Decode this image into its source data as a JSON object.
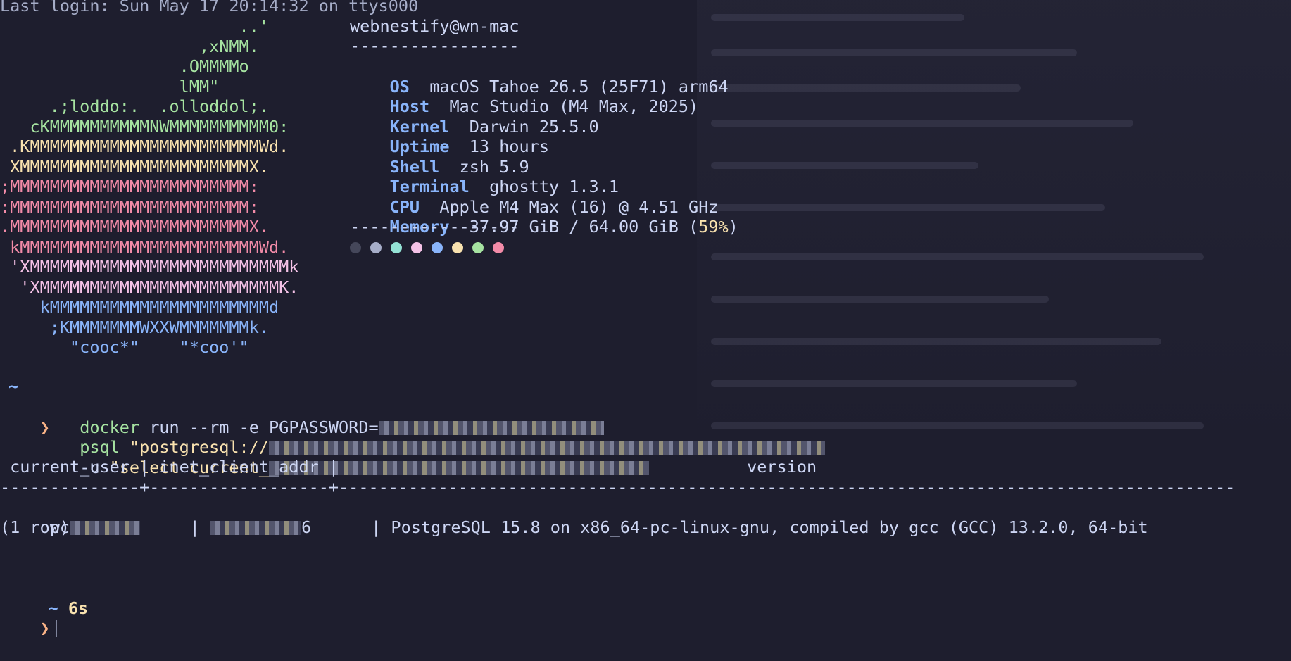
{
  "terminal": {
    "last_login": "Last login: Sun May 17 20:14:32 on ttys000",
    "logo": [
      {
        "text": "                        ..'",
        "color": "green"
      },
      {
        "text": "                    ,xNMM.",
        "color": "green"
      },
      {
        "text": "                  .OMMMMo",
        "color": "green"
      },
      {
        "text": "                  lMM\"",
        "color": "green"
      },
      {
        "text": "     .;loddo:.  .olloddol;.",
        "color": "green"
      },
      {
        "text": "   cKMMMMMMMMMMNWMMMMMMMMMM0:",
        "color": "green"
      },
      {
        "text": " .KMMMMMMMMMMMMMMMMMMMMMMMWd.",
        "color": "yellow"
      },
      {
        "text": " XMMMMMMMMMMMMMMMMMMMMMMMX.",
        "color": "yellow"
      },
      {
        "text": ";MMMMMMMMMMMMMMMMMMMMMMMM:",
        "color": "red"
      },
      {
        "text": ":MMMMMMMMMMMMMMMMMMMMMMMM:",
        "color": "red"
      },
      {
        "text": ".MMMMMMMMMMMMMMMMMMMMMMMMX.",
        "color": "red"
      },
      {
        "text": " kMMMMMMMMMMMMMMMMMMMMMMMMWd.",
        "color": "red"
      },
      {
        "text": " 'XMMMMMMMMMMMMMMMMMMMMMMMMMMk",
        "color": "pink"
      },
      {
        "text": "  'XMMMMMMMMMMMMMMMMMMMMMMMMK.",
        "color": "pink"
      },
      {
        "text": "    kMMMMMMMMMMMMMMMMMMMMMMd",
        "color": "blue"
      },
      {
        "text": "     ;KMMMMMMMWXXWMMMMMMMk.",
        "color": "blue"
      },
      {
        "text": "       \"cooc*\"    \"*coo'\"",
        "color": "blue"
      }
    ],
    "sysinfo": {
      "user_host": "webnestify@wn-mac",
      "separator": "-----------------",
      "rows": [
        {
          "key": "OS",
          "value": "macOS Tahoe 26.5 (25F71) arm64"
        },
        {
          "key": "Host",
          "value": "Mac Studio (M4 Max, 2025)"
        },
        {
          "key": "Kernel",
          "value": "Darwin 25.5.0"
        },
        {
          "key": "Uptime",
          "value": "13 hours"
        },
        {
          "key": "Shell",
          "value": "zsh 5.9"
        },
        {
          "key": "Terminal",
          "value": "ghostty 1.3.1"
        },
        {
          "key": "CPU",
          "value": "Apple M4 Max (16) @ 4.51 GHz"
        }
      ],
      "memory_key": "Memory",
      "memory_value": "37.97 GiB / 64.00 GiB (",
      "memory_pct": "59%",
      "memory_close": ")",
      "palette": [
        "#45475a",
        "#a6adc8",
        "#94e2d5",
        "#f5c2e7",
        "#89b4fa",
        "#f9e2af",
        "#a6e3a1",
        "#f38ba8"
      ]
    },
    "prompt1": {
      "dir": "~",
      "arrow": "❯",
      "cmd_name": "docker",
      "cmd_args": " run --rm -e PGPASSWORD=",
      "line2_cmd": "psql",
      "line2_str": " \"postgresql://",
      "line3_flag": "-c",
      "line3_str": " \"select current_"
    },
    "output": {
      "header": " current_user | inet_client_addr |                                         version",
      "divider": "--------------+------------------+------------------------------------------------------------------------------------------",
      "row_user": " pc",
      "row_sep1": "     | ",
      "row_ip_tail": "6",
      "row_sep2": "      | PostgreSQL 15.8 on x86_64-pc-linux-gnu, compiled by gcc (GCC) 13.2.0, 64-bit",
      "rowcount": "(1 row)"
    },
    "prompt2": {
      "dir": "~",
      "duration": "6s",
      "arrow": "❯"
    }
  }
}
